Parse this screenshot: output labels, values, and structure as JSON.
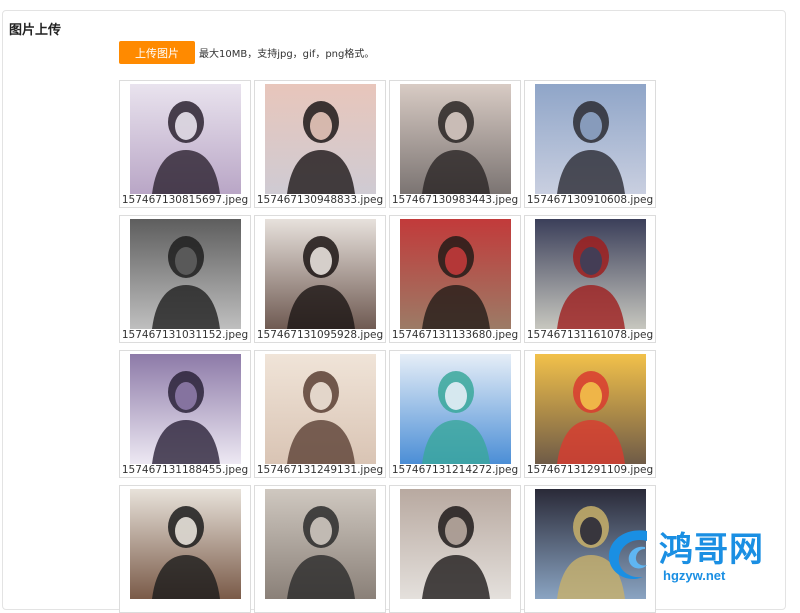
{
  "page": {
    "title": "图片上传",
    "upload_button": "上传图片",
    "hint": "最大10MB，支持jpg，gif，png格式。"
  },
  "colors": {
    "accent": "#ff8a00",
    "watermark": "#1a8fe3",
    "border": "#dcdcdc"
  },
  "images": [
    {
      "filename": "157467130815697.jpeg",
      "palette": [
        "#b9a6c6",
        "#2c2230",
        "#e9e3ee"
      ]
    },
    {
      "filename": "157467130948833.jpeg",
      "palette": [
        "#cfcbd3",
        "#1d1718",
        "#e8c6bb"
      ]
    },
    {
      "filename": "157467130983443.jpeg",
      "palette": [
        "#7b7472",
        "#2a2625",
        "#d8cbc4"
      ]
    },
    {
      "filename": "157467130910608.jpeg",
      "palette": [
        "#c9cfe0",
        "#2b2b33",
        "#8fa5c8"
      ]
    },
    {
      "filename": "157467131031152.jpeg",
      "palette": [
        "#bfbfbf",
        "#1f1f1f",
        "#5e5e5e"
      ]
    },
    {
      "filename": "157467131095928.jpeg",
      "palette": [
        "#6f5a52",
        "#1c1514",
        "#e7e1dc"
      ]
    },
    {
      "filename": "157467131133680.jpeg",
      "palette": [
        "#9c7b66",
        "#231b18",
        "#c23a3a"
      ]
    },
    {
      "filename": "157467131161078.jpeg",
      "palette": [
        "#c7c7bf",
        "#9e1e1e",
        "#3b3f5a"
      ]
    },
    {
      "filename": "157467131188455.jpeg",
      "palette": [
        "#ede8f3",
        "#2a2238",
        "#8d7aa8"
      ]
    },
    {
      "filename": "157467131249131.jpeg",
      "palette": [
        "#d9c4b4",
        "#5b4034",
        "#f0e4d8"
      ]
    },
    {
      "filename": "157467131214272.jpeg",
      "palette": [
        "#4b8ed6",
        "#3aa89b",
        "#e6eef7"
      ]
    },
    {
      "filename": "157467131291109.jpeg",
      "palette": [
        "#6f5b47",
        "#d93b2f",
        "#f2c14a"
      ]
    },
    {
      "filename": "",
      "palette": [
        "#7a5a48",
        "#1c1c1c",
        "#e8e2da"
      ]
    },
    {
      "filename": "",
      "palette": [
        "#8a8078",
        "#2b2b2b",
        "#cfc8c0"
      ]
    },
    {
      "filename": "",
      "palette": [
        "#e4e0dc",
        "#1e1a1a",
        "#b8a9a0"
      ]
    },
    {
      "filename": "",
      "palette": [
        "#8aa4c2",
        "#c8b06a",
        "#2a2a38"
      ]
    }
  ],
  "watermark": {
    "name": "鸿哥网",
    "url": "hgzyw.net"
  }
}
